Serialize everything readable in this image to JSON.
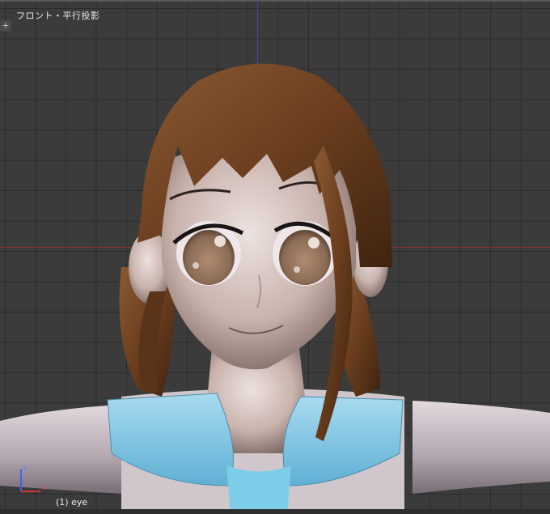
{
  "viewport": {
    "view_label": "フロント・平行投影",
    "object_label": "(1) eye",
    "add_button": "+"
  },
  "gizmo": {
    "z_label": "z",
    "x_label": "x"
  },
  "colors": {
    "background": "#3b3b3b",
    "x_axis": "#8f3434",
    "z_axis": "#3d46b8",
    "hair": "#6b3e1e",
    "skin": "#c9b3ad",
    "collar": "#7fc3df"
  },
  "scene": {
    "subject": "character-model"
  }
}
